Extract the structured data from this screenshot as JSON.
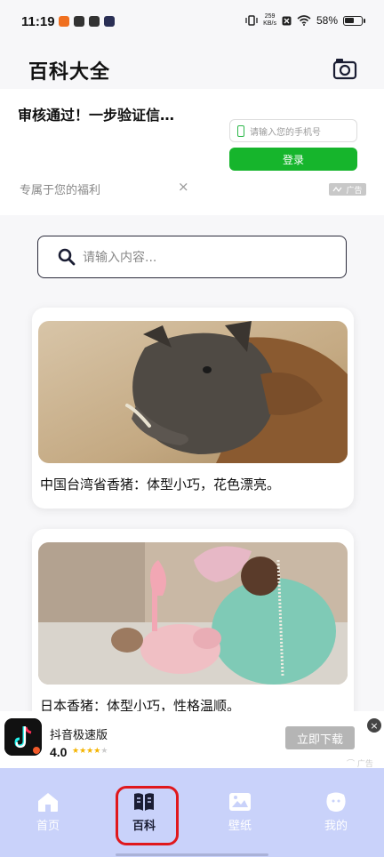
{
  "status_bar": {
    "time": "11:19",
    "net_speed_value": "259",
    "net_speed_unit": "KB/s",
    "battery_text": "58%",
    "battery_level": 0.58
  },
  "header": {
    "title": "百科大全",
    "camera_icon": "camera-icon"
  },
  "ad_banner": {
    "headline": "审核通过！一步验证信…",
    "phone_placeholder": "请输入您的手机号",
    "login_label": "登录",
    "subtitle": "专属于您的福利",
    "close_label": "×",
    "ad_label": "广告"
  },
  "search": {
    "placeholder": "请输入内容..."
  },
  "cards": [
    {
      "caption": "中国台湾省香猪：体型小巧，花色漂亮。"
    },
    {
      "caption": "日本香猪：体型小巧，性格温顺。"
    }
  ],
  "app_ad": {
    "name": "抖音极速版",
    "rating": "4.0",
    "stars": 4,
    "download_label": "立即下载",
    "close_label": "×",
    "ad_label": "广告"
  },
  "nav": {
    "items": [
      {
        "label": "首页",
        "icon": "home-icon"
      },
      {
        "label": "百科",
        "icon": "book-icon"
      },
      {
        "label": "壁纸",
        "icon": "picture-icon"
      },
      {
        "label": "我的",
        "icon": "profile-icon"
      }
    ],
    "active_index": 1
  },
  "colors": {
    "accent_green": "#16b52c",
    "nav_bg": "#c9d2fa",
    "highlight_red": "#e0181c"
  }
}
